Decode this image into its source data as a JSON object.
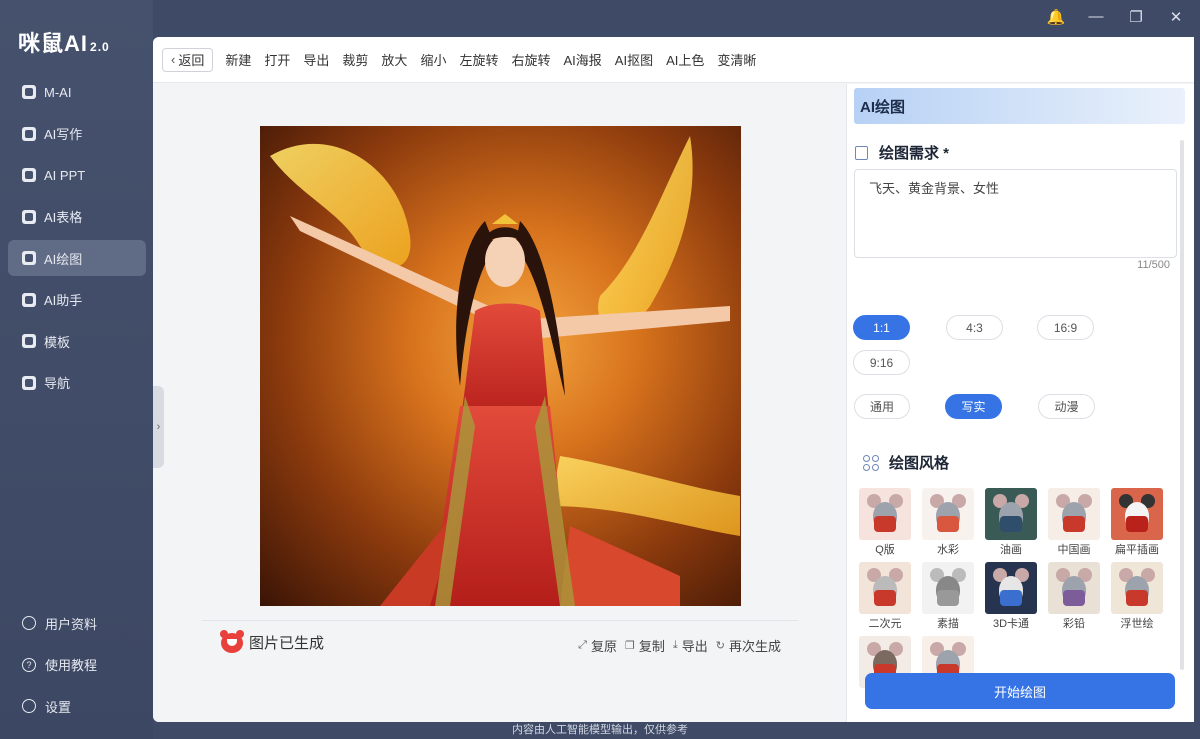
{
  "app": {
    "logo": "咪鼠AI",
    "version": "2.0"
  },
  "sidebar": {
    "items": [
      {
        "label": "M-AI",
        "icon": "m-ai-icon"
      },
      {
        "label": "AI写作",
        "icon": "writing-icon"
      },
      {
        "label": "AI PPT",
        "icon": "ppt-icon"
      },
      {
        "label": "AI表格",
        "icon": "table-icon"
      },
      {
        "label": "AI绘图",
        "icon": "drawing-icon",
        "active": true
      },
      {
        "label": "AI助手",
        "icon": "assistant-icon"
      },
      {
        "label": "模板",
        "icon": "template-icon"
      },
      {
        "label": "导航",
        "icon": "navigation-icon"
      }
    ],
    "bottom": [
      {
        "label": "用户资料",
        "icon": "user-icon"
      },
      {
        "label": "使用教程",
        "icon": "help-icon"
      },
      {
        "label": "设置",
        "icon": "gear-icon"
      }
    ]
  },
  "window": {
    "bell": "🔔",
    "minimize": "—",
    "restore": "❐",
    "close": "✕"
  },
  "toolbar": {
    "back": "返回",
    "tools": [
      "新建",
      "打开",
      "导出",
      "裁剪",
      "放大",
      "缩小",
      "左旋转",
      "右旋转",
      "AI海报",
      "AI抠图",
      "AI上色",
      "变清晰"
    ]
  },
  "canvas": {
    "status": "图片已生成",
    "actions": [
      "复原",
      "复制",
      "导出",
      "再次生成"
    ]
  },
  "panel": {
    "title": "AI绘图",
    "prompt_title": "绘图需求 *",
    "prompt_value": "飞天、黄金背景、女性",
    "counter": "11/500",
    "ratios": [
      "1:1",
      "4:3",
      "16:9",
      "9:16"
    ],
    "ratio_selected": "1:1",
    "modes": [
      "通用",
      "写实",
      "动漫"
    ],
    "mode_selected": "写实",
    "style_title": "绘图风格",
    "styles": [
      "Q版",
      "水彩",
      "油画",
      "中国画",
      "扁平插画",
      "二次元",
      "素描",
      "3D卡通",
      "彩铅",
      "浮世绘",
      "",
      ""
    ],
    "start": "开始绘图"
  },
  "footer": "内容由人工智能模型输出，仅供参考",
  "colors": {
    "accent": "#3674e6",
    "sidebar": "#46526d",
    "active_item": "#606b86"
  }
}
